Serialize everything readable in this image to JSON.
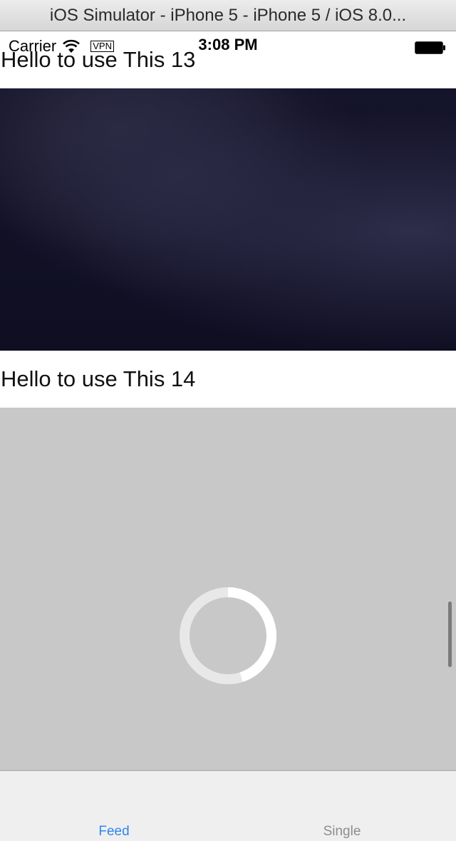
{
  "window": {
    "title": "iOS Simulator - iPhone 5 - iPhone 5 / iOS 8.0..."
  },
  "status_bar": {
    "carrier": "Carrier",
    "vpn": "VPN",
    "time": "3:08 PM",
    "icons": [
      "wifi-icon",
      "battery-icon"
    ]
  },
  "feed": {
    "items": [
      {
        "label": "Hello to use This 13",
        "image_state": "loaded"
      },
      {
        "label": "Hello to use This 14",
        "image_state": "loading"
      }
    ]
  },
  "loading": {
    "progress": 0.45,
    "track_color": "#e8e8e8",
    "progress_color": "#ffffff"
  },
  "tab_bar": {
    "tabs": [
      {
        "label": "Feed",
        "selected": true
      },
      {
        "label": "Single",
        "selected": false
      }
    ],
    "active_color": "#2f86ef",
    "inactive_color": "#8e8e8e"
  }
}
